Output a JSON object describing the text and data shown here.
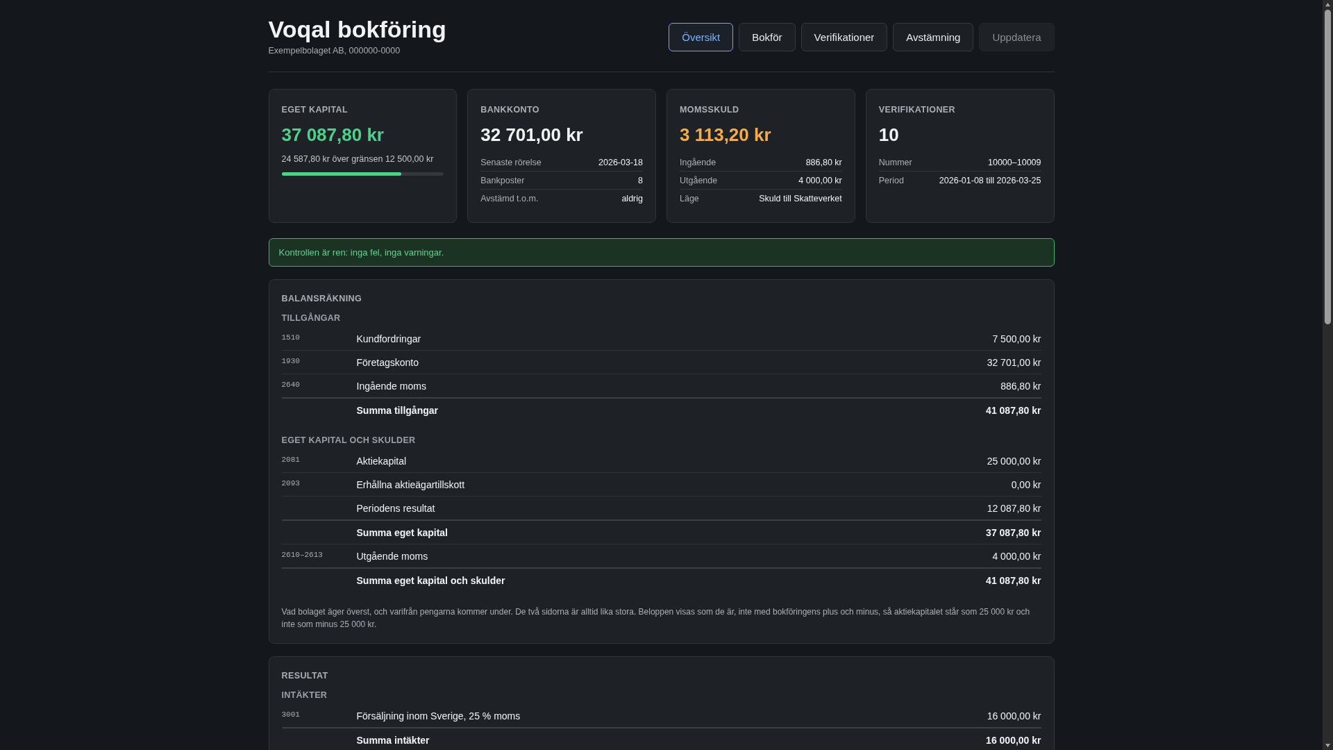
{
  "header": {
    "title": "Voqal bokföring",
    "subtitle": "Exempelbolaget AB, 000000-0000"
  },
  "tabs": [
    {
      "label": "Översikt",
      "selected": true
    },
    {
      "label": "Bokför",
      "selected": false
    },
    {
      "label": "Verifikationer",
      "selected": false
    },
    {
      "label": "Avstämning",
      "selected": false
    }
  ],
  "refresh_button": {
    "label": "Uppdatera",
    "disabled": true
  },
  "cards": [
    {
      "label": "EGET KAPITAL",
      "value": "37 087,80 kr",
      "color": "#4fd08b",
      "note": "24 587,80 kr över gränsen 12 500,00 kr",
      "level": 0.74
    },
    {
      "label": "BANKKONTO",
      "value": "32 701,00 kr",
      "color": "#f1f3f5",
      "details": [
        {
          "label": "Senaste rörelse",
          "value": "2026-03-18"
        },
        {
          "label": "Bankposter",
          "value": "8"
        },
        {
          "label": "Avstämd t.o.m.",
          "value": "aldrig"
        }
      ]
    },
    {
      "label": "MOMSSKULD",
      "value": "3 113,20 kr",
      "color": "#f0ad4e",
      "details": [
        {
          "label": "Ingående",
          "value": "886,80 kr"
        },
        {
          "label": "Utgående",
          "value": "4 000,00 kr"
        },
        {
          "label": "Läge",
          "value": "Skuld till Skatteverket"
        }
      ]
    },
    {
      "label": "VERIFIKATIONER",
      "value": "10",
      "color": "#f1f3f5",
      "details": [
        {
          "label": "Nummer",
          "value": "10000–10009"
        },
        {
          "label": "Period",
          "value": "2026-01-08 till 2026-03-25"
        }
      ]
    }
  ],
  "alert": {
    "text": "Kontrollen är ren: inga fel, inga varningar."
  },
  "sections": [
    {
      "title": "BALANSRÄKNING",
      "groups": [
        {
          "title": "TILLGÅNGAR",
          "rows": [
            {
              "kind": "row",
              "account": "1510",
              "name": "Kundfordringar",
              "amount": "7 500,00 kr"
            },
            {
              "kind": "row",
              "account": "1930",
              "name": "Företagskonto",
              "amount": "32 701,00 kr"
            },
            {
              "kind": "row",
              "account": "2640",
              "name": "Ingående moms",
              "amount": "886,80 kr"
            },
            {
              "kind": "sum",
              "name": "Summa tillgångar",
              "amount": "41 087,80 kr"
            }
          ]
        },
        {
          "title": "EGET KAPITAL OCH SKULDER",
          "rows": [
            {
              "kind": "row",
              "account": "2081",
              "name": "Aktiekapital",
              "amount": "25 000,00 kr"
            },
            {
              "kind": "row",
              "account": "2093",
              "name": "Erhållna aktieägartillskott",
              "amount": "0,00 kr"
            },
            {
              "kind": "row",
              "name": "Periodens resultat",
              "amount": "12 087,80 kr"
            },
            {
              "kind": "sum",
              "name": "Summa eget kapital",
              "amount": "37 087,80 kr"
            },
            {
              "kind": "row",
              "account": "2610–2613",
              "name": "Utgående moms",
              "amount": "4 000,00 kr"
            },
            {
              "kind": "sum",
              "name": "Summa eget kapital och skulder",
              "amount": "41 087,80 kr"
            }
          ]
        }
      ],
      "note": "Vad bolaget äger överst, och varifrån pengarna kommer under. De två sidorna är alltid lika stora. Beloppen visas som de är, inte med bokföringens plus och minus, så aktiekapitalet står som 25 000 kr och inte som minus 25 000 kr."
    },
    {
      "title": "RESULTAT",
      "groups": [
        {
          "title": "INTÄKTER",
          "rows": [
            {
              "kind": "row",
              "account": "3001",
              "name": "Försäljning inom Sverige, 25 % moms",
              "amount": "16 000,00 kr"
            },
            {
              "kind": "sum",
              "name": "Summa intäkter",
              "amount": "16 000,00 kr"
            }
          ]
        }
      ]
    }
  ]
}
